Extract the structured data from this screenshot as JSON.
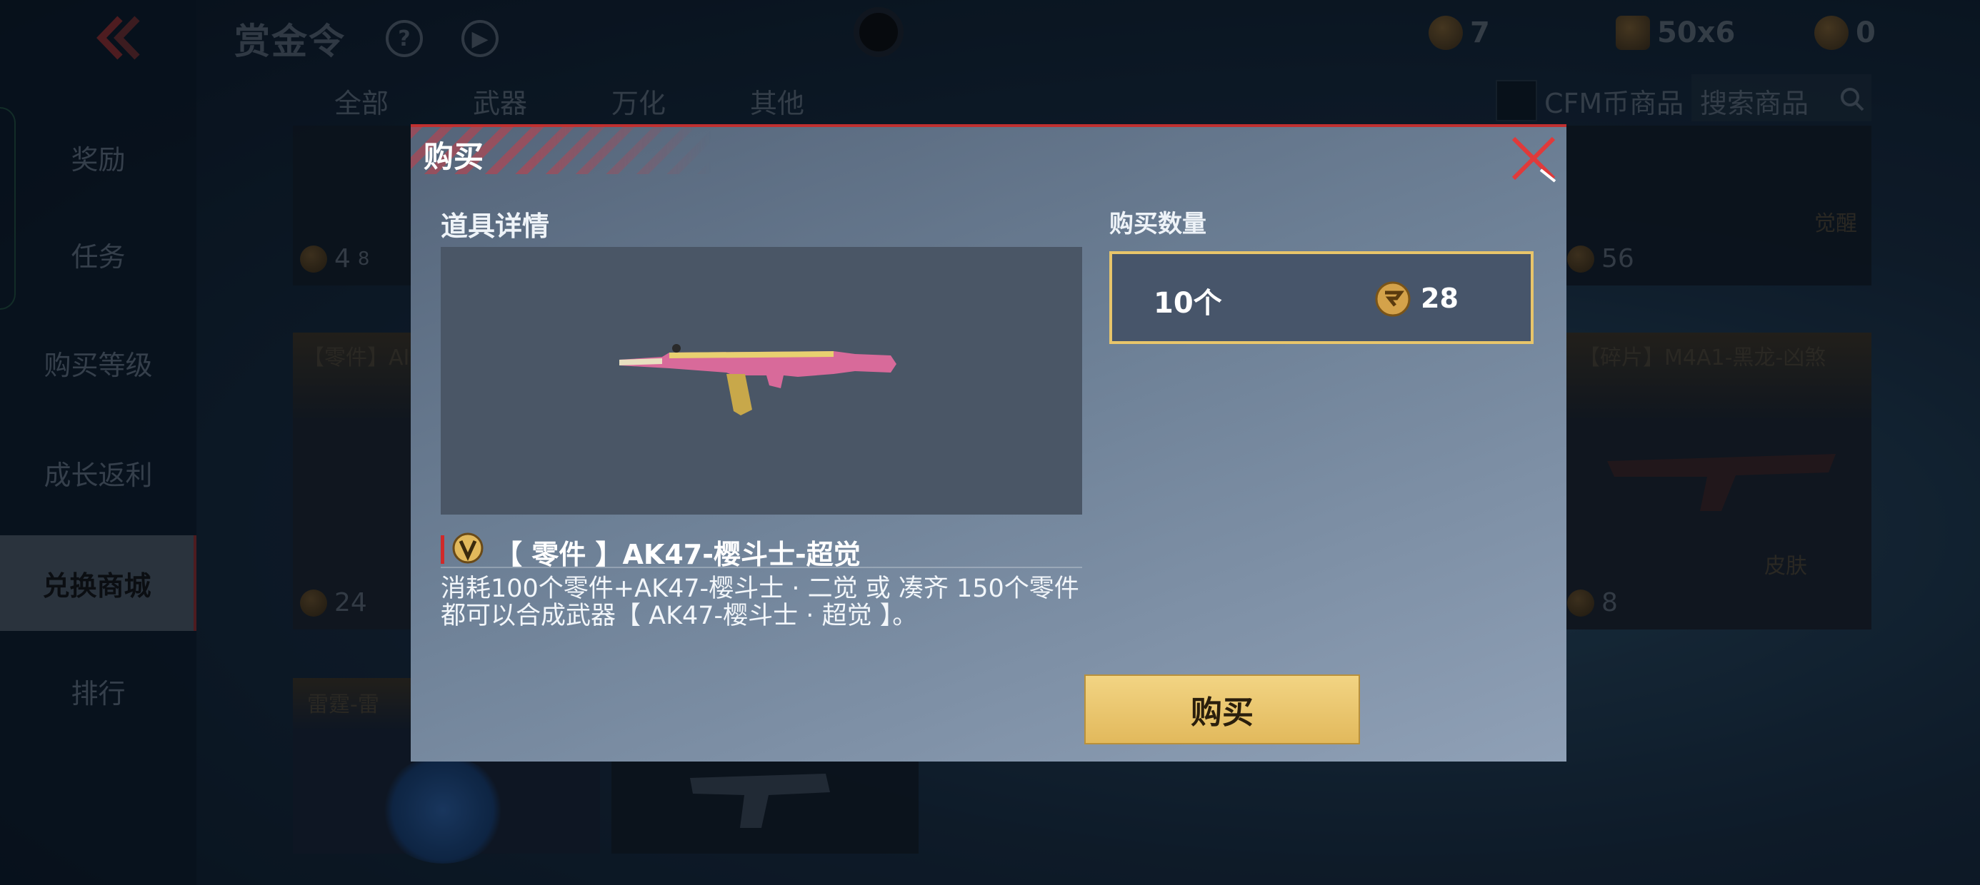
{
  "header": {
    "title": "赏金令",
    "help_icon": "help-circle-icon",
    "play_icon": "play-circle-icon",
    "currencies": [
      {
        "icon": "medal-coin-icon",
        "value": "7"
      },
      {
        "icon": "crate-token-icon",
        "value": "50x6"
      },
      {
        "icon": "cf-coin-add-icon",
        "value": "0"
      }
    ]
  },
  "sidebar": {
    "items": [
      {
        "label": "奖励"
      },
      {
        "label": "任务"
      },
      {
        "label": "购买等级"
      },
      {
        "label": "成长返利"
      },
      {
        "label": "兑换商城",
        "active": true
      },
      {
        "label": "排行"
      }
    ]
  },
  "tabs": [
    "全部",
    "武器",
    "万化",
    "其他"
  ],
  "filter": {
    "cfm_label": "CFM币商品",
    "search_placeholder": "搜索商品"
  },
  "shop": {
    "tiles": [
      {
        "price": "4",
        "extra": "8"
      },
      {
        "price": "56",
        "tag": "觉醒"
      },
      {
        "name": "【零件】AI",
        "price": "24"
      },
      {
        "name": "【碎片】M4A1-黑龙-凶煞",
        "price": "8",
        "tag": "皮肤"
      },
      {
        "name": "雷霆-雷"
      }
    ]
  },
  "dialog": {
    "title": "购买",
    "detail_label": "道具详情",
    "qty_label": "购买数量",
    "item_name": "【 零件 】AK47-樱斗士-超觉",
    "item_desc": "消耗100个零件+AK47-樱斗士 · 二觉 或 凑齐 150个零件都可以合成武器【 AK47-樱斗士 · 超觉 】。",
    "qty_value": "10个",
    "qty_price": "28",
    "buy_label": "购买"
  },
  "colors": {
    "accent_red": "#c03030",
    "gold": "#e8c56a",
    "dialog_bg": "#6d8096"
  }
}
